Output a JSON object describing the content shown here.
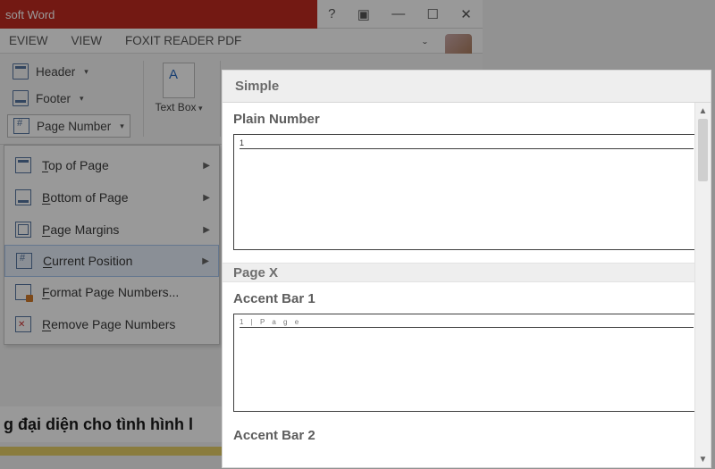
{
  "title": "soft Word",
  "syscontrols": {
    "help": "?",
    "opts": "▣",
    "min": "—",
    "max": "☐",
    "close": "✕"
  },
  "tabs": {
    "review": "EVIEW",
    "view": "VIEW",
    "foxit": "FOXIT READER PDF"
  },
  "ribbon": {
    "header": "Header",
    "footer": "Footer",
    "pagenum": "Page Number",
    "textbox": "Text\nBox"
  },
  "pagenum_menu": {
    "top": "Top of Page",
    "bottom": "Bottom of Page",
    "margins": "Page Margins",
    "current": "Current Position",
    "format": "Format Page Numbers...",
    "remove": "Remove Page Numbers",
    "ul": {
      "top": "T",
      "bottom": "B",
      "margins": "P",
      "current": "C",
      "format": "F",
      "remove": "R"
    }
  },
  "gallery": {
    "group_simple": "Simple",
    "item_plain": "Plain Number",
    "plain_preview": "1",
    "group_pagex": "Page X",
    "item_accent1": "Accent Bar 1",
    "accent1_preview": "1 | P a g e",
    "item_accent2": "Accent Bar 2"
  },
  "doc_text": "g đại diện cho tình hình l"
}
